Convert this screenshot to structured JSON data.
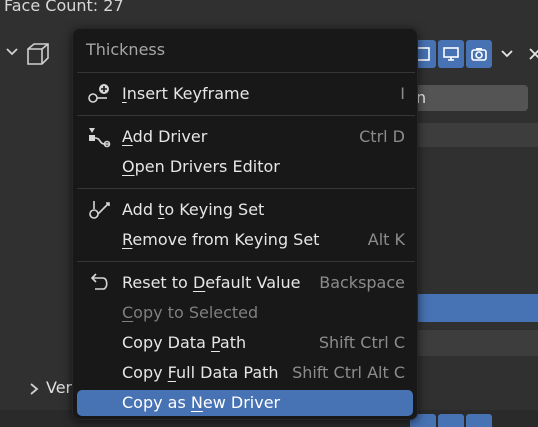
{
  "background": {
    "face_count": "Face Count: 27",
    "field_partial": "n",
    "ver_label": "Ver"
  },
  "menu": {
    "title": "Thickness",
    "items": [
      {
        "label_pre": "",
        "label_u": "I",
        "label_post": "nsert Keyframe",
        "shortcut": "I",
        "icon": "keyframe-insert-icon"
      },
      {
        "label_pre": "",
        "label_u": "A",
        "label_post": "dd Driver",
        "shortcut": "Ctrl D",
        "icon": "driver-icon"
      },
      {
        "label_pre": "",
        "label_u": "O",
        "label_post": "pen Drivers Editor",
        "shortcut": "",
        "icon": ""
      },
      {
        "label_pre": "Add ",
        "label_u": "t",
        "label_post": "o Keying Set",
        "shortcut": "",
        "icon": "keying-set-icon"
      },
      {
        "label_pre": "",
        "label_u": "R",
        "label_post": "emove from Keying Set",
        "shortcut": "Alt K",
        "icon": ""
      },
      {
        "label_pre": "Reset to ",
        "label_u": "D",
        "label_post": "efault Value",
        "shortcut": "Backspace",
        "icon": "reset-icon"
      },
      {
        "label_pre": "",
        "label_u": "C",
        "label_post": "opy to Selected",
        "shortcut": "",
        "icon": ""
      },
      {
        "label_pre": "Copy Data ",
        "label_u": "P",
        "label_post": "ath",
        "shortcut": "Shift Ctrl C",
        "icon": ""
      },
      {
        "label_pre": "Copy ",
        "label_u": "F",
        "label_post": "ull Data Path",
        "shortcut": "Shift Ctrl Alt C",
        "icon": ""
      },
      {
        "label_pre": "Copy as ",
        "label_u": "N",
        "label_post": "ew Driver",
        "shortcut": "",
        "icon": ""
      }
    ]
  },
  "colors": {
    "accent": "#4772b3",
    "menu_bg": "#181818",
    "panel_bg": "#303030"
  }
}
